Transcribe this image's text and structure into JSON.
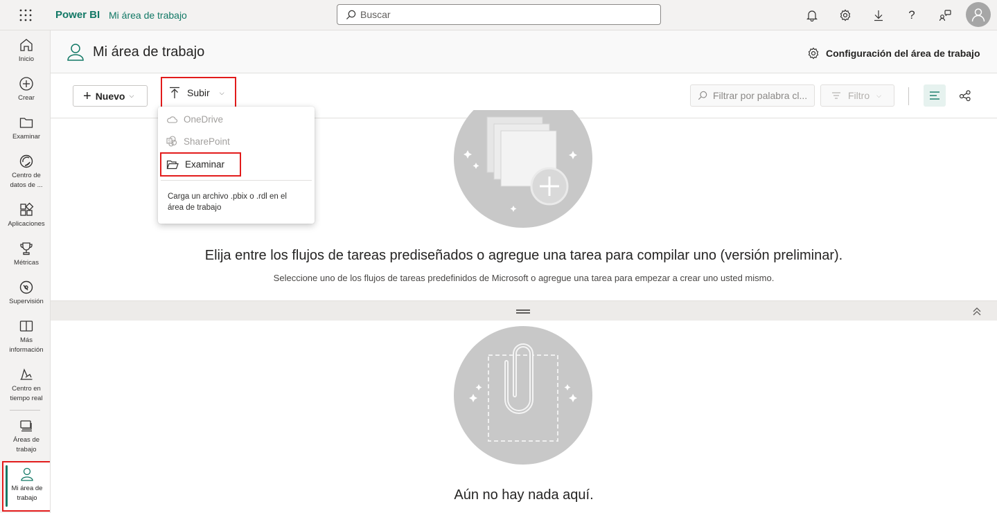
{
  "app": {
    "name": "Power BI",
    "breadcrumb": "Mi área de trabajo",
    "accent_color": "#117865",
    "highlight_color": "#e21b1b"
  },
  "search": {
    "placeholder": "Buscar"
  },
  "top_icons": [
    "bell-icon",
    "gear-icon",
    "download-icon",
    "help-icon",
    "feedback-icon",
    "account-icon"
  ],
  "nav": {
    "items": [
      {
        "label": "Inicio",
        "icon": "home-icon"
      },
      {
        "label": "Crear",
        "icon": "plus-circle-icon"
      },
      {
        "label": "Examinar",
        "icon": "folder-icon"
      },
      {
        "label": "Centro de datos de ...",
        "icon": "data-hub-icon"
      },
      {
        "label": "Aplicaciones",
        "icon": "apps-icon"
      },
      {
        "label": "Métricas",
        "icon": "trophy-icon"
      },
      {
        "label": "Supervisión",
        "icon": "monitor-icon"
      },
      {
        "label": "Más información",
        "icon": "book-icon"
      },
      {
        "label": "Centro en tiempo real",
        "icon": "realtime-icon"
      },
      {
        "label": "Áreas de trabajo",
        "icon": "workspaces-icon"
      },
      {
        "label": "Mi área de trabajo",
        "icon": "person-icon",
        "active": true
      }
    ]
  },
  "workspace": {
    "title": "Mi área de trabajo",
    "settings_label": "Configuración del área de trabajo"
  },
  "toolbar": {
    "new_label": "Nuevo",
    "upload_label": "Subir",
    "filter_placeholder": "Filtrar por palabra cl...",
    "filter_button": "Filtro"
  },
  "upload_menu": {
    "items": [
      {
        "label": "OneDrive",
        "enabled": false
      },
      {
        "label": "SharePoint",
        "enabled": false
      },
      {
        "label": "Examinar",
        "enabled": true
      }
    ],
    "hint": "Carga un archivo .pbix o .rdl en el área de trabajo"
  },
  "tasks": {
    "title": "Elija entre los flujos de tareas prediseñados o agregue una tarea para compilar uno (versión preliminar).",
    "subtitle": "Seleccione uno de los flujos de tareas predefinidos de Microsoft o agregue una tarea para empezar a crear uno usted mismo."
  },
  "empty_state": {
    "title": "Aún no hay nada aquí."
  }
}
